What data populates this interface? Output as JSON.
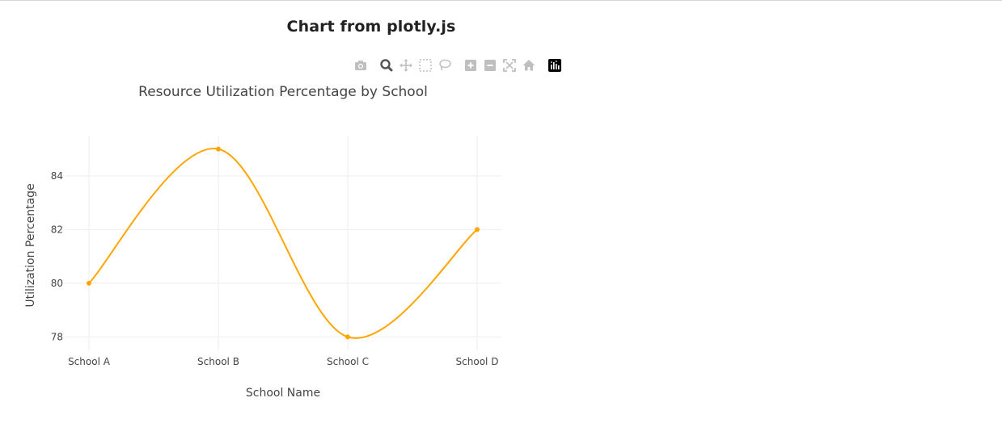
{
  "page": {
    "heading": "Chart from plotly.js"
  },
  "modebar": {
    "buttons": [
      {
        "name": "camera-icon"
      },
      {
        "name": "zoom-icon"
      },
      {
        "name": "pan-icon"
      },
      {
        "name": "box-select-icon"
      },
      {
        "name": "lasso-select-icon"
      },
      {
        "name": "zoom-in-icon"
      },
      {
        "name": "zoom-out-icon"
      },
      {
        "name": "autoscale-icon"
      },
      {
        "name": "reset-axes-icon"
      },
      {
        "name": "plotly-logo-icon"
      }
    ]
  },
  "chart_data": {
    "type": "line",
    "title": "Resource Utilization Percentage by School",
    "xlabel": "School Name",
    "ylabel": "Utilization Percentage",
    "categories": [
      "School A",
      "School B",
      "School C",
      "School D"
    ],
    "series": [
      {
        "values": [
          80,
          85,
          78,
          82
        ],
        "color": "#FFA500",
        "line_shape": "spline",
        "markers": true
      }
    ],
    "ylim": [
      77.5,
      85.5
    ],
    "yticks": [
      78,
      80,
      82,
      84
    ],
    "grid": true
  }
}
